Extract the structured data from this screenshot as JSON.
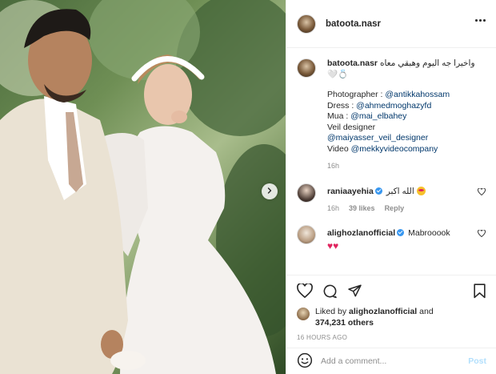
{
  "post": {
    "username": "batoota.nasr",
    "caption": {
      "username": "batoota.nasr",
      "text": "واخيرا جه اليوم وهبقي معاه 💍🤍",
      "credits": [
        {
          "label": "Photographer : ",
          "link": "@antikkahossam"
        },
        {
          "label": "Dress : ",
          "link": "@ahmedmoghazyfd"
        },
        {
          "label": "Mua : ",
          "link": "@mai_elbahey"
        },
        {
          "label": "Veil designer",
          "link": ""
        },
        {
          "label": "",
          "link": "@maiyasser_veil_designer"
        },
        {
          "label": "Video ",
          "link": "@mekkyvideocompany"
        }
      ],
      "time": "16h"
    },
    "comments": [
      {
        "username": "raniaayehia",
        "verified": true,
        "text": "الله اكبر",
        "time": "16h",
        "likes": "39 likes",
        "reply": "Reply"
      },
      {
        "username": "alighozlanofficial",
        "verified": true,
        "text": "Mabrooook",
        "hearts": "♥♥"
      }
    ],
    "likes": {
      "prefix": "Liked by",
      "first": "alighozlanofficial",
      "joiner": "and",
      "others": "374,231 others"
    },
    "timestamp": "16 HOURS AGO",
    "comment_input": {
      "placeholder": "Add a comment...",
      "post_label": "Post"
    }
  },
  "icons": {
    "more": "more-options-icon",
    "next": "chevron-right-icon",
    "like": "heart-icon",
    "comment": "comment-bubble-icon",
    "share": "paper-plane-icon",
    "save": "bookmark-icon",
    "emoji": "smiley-icon"
  },
  "colors": {
    "link": "#00376b",
    "muted": "#8e8e8e",
    "verified": "#3897f0",
    "post_button": "#b2dffc"
  }
}
